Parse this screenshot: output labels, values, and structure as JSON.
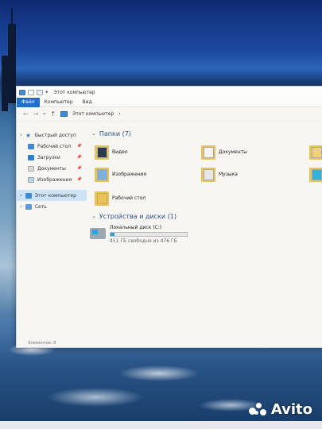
{
  "window": {
    "title": "Этот компьютер"
  },
  "ribbon": {
    "tabs": [
      "Файл",
      "Компьютер",
      "Вид"
    ]
  },
  "address": {
    "path": "Этот компьютер",
    "separator": "›"
  },
  "sidebar": {
    "quick_access": "Быстрый доступ",
    "items": [
      "Рабочий стол",
      "Загрузки",
      "Документы",
      "Изображения"
    ],
    "this_pc": "Этот компьютер",
    "network": "Сеть"
  },
  "folders": {
    "header": "Папки (7)",
    "items": [
      "Видео",
      "Документы",
      "Изображения",
      "Музыка",
      "Рабочий стол"
    ]
  },
  "devices": {
    "header": "Устройства и диски (1)",
    "drive_name": "Локальный диск (C:)",
    "drive_free": "451 ГБ свободно из 476 ГБ",
    "used_fraction": 0.05
  },
  "status": {
    "items": "Элементов: 8"
  },
  "watermark": {
    "text": "Avito"
  },
  "colors": {
    "accent": "#1c6fce",
    "selection": "#cde3f7",
    "folder": "#e8c35a",
    "bar_fill": "#26a0da"
  }
}
